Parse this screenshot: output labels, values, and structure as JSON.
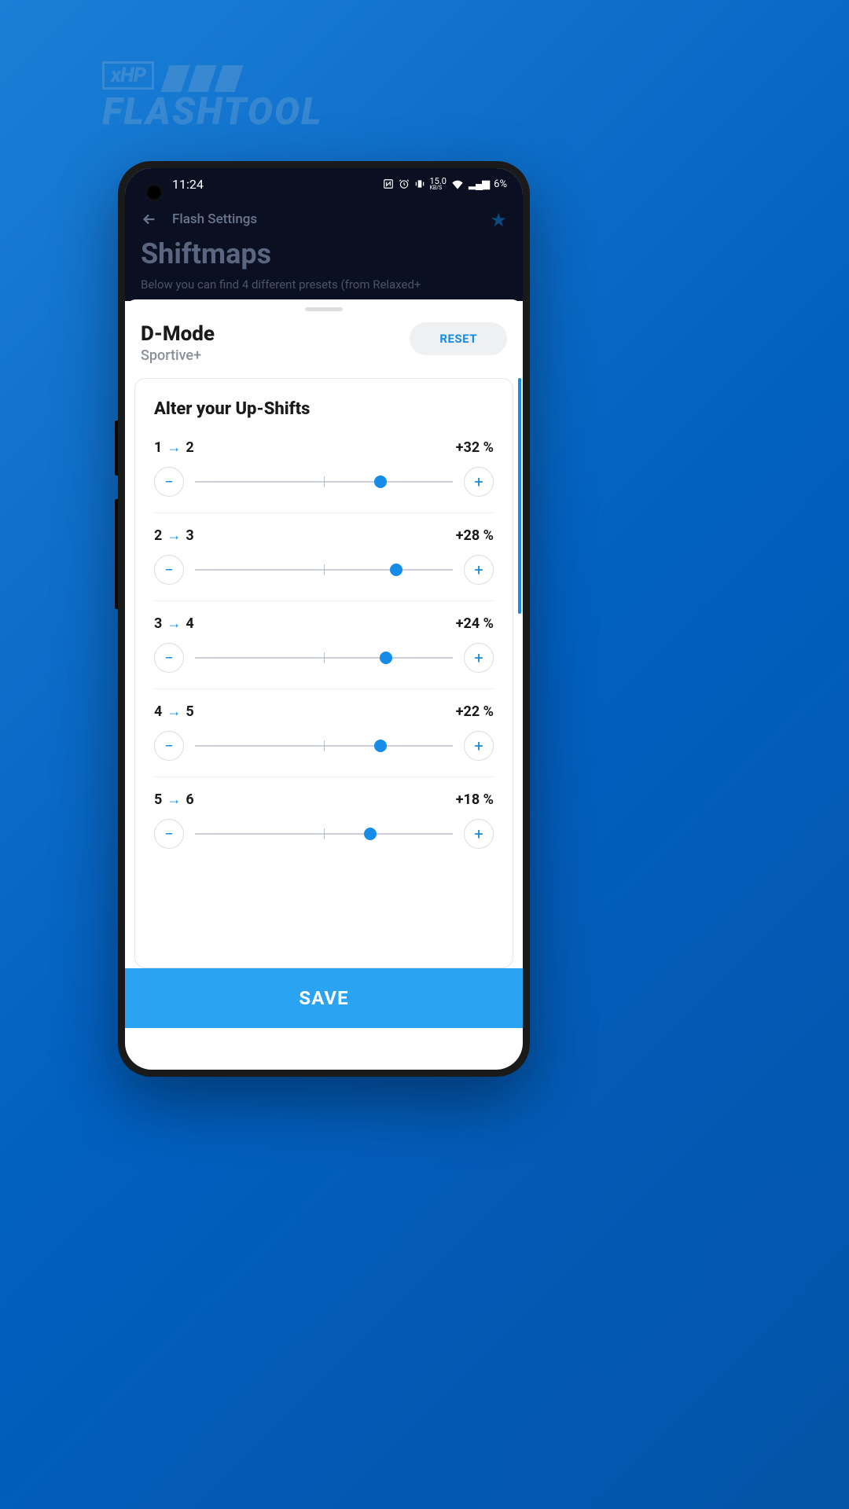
{
  "brand": {
    "badge": "xHP",
    "name": "FLASHTOOL"
  },
  "status": {
    "time": "11:24",
    "speed": "15.0",
    "speed_unit": "KB/S",
    "battery": "6%"
  },
  "nav": {
    "title": "Flash Settings"
  },
  "page": {
    "title": "Shiftmaps",
    "desc": "Below you can find 4 different presets (from Relaxed+"
  },
  "mode": {
    "title": "D-Mode",
    "subtitle": "Sportive+",
    "reset": "RESET"
  },
  "card": {
    "title": "Alter your Up-Shifts"
  },
  "shifts": [
    {
      "from": "1",
      "to": "2",
      "value": "+32 %",
      "pos": 72
    },
    {
      "from": "2",
      "to": "3",
      "value": "+28 %",
      "pos": 78
    },
    {
      "from": "3",
      "to": "4",
      "value": "+24 %",
      "pos": 74
    },
    {
      "from": "4",
      "to": "5",
      "value": "+22 %",
      "pos": 72
    },
    {
      "from": "5",
      "to": "6",
      "value": "+18 %",
      "pos": 68
    }
  ],
  "footer": {
    "save": "SAVE"
  }
}
